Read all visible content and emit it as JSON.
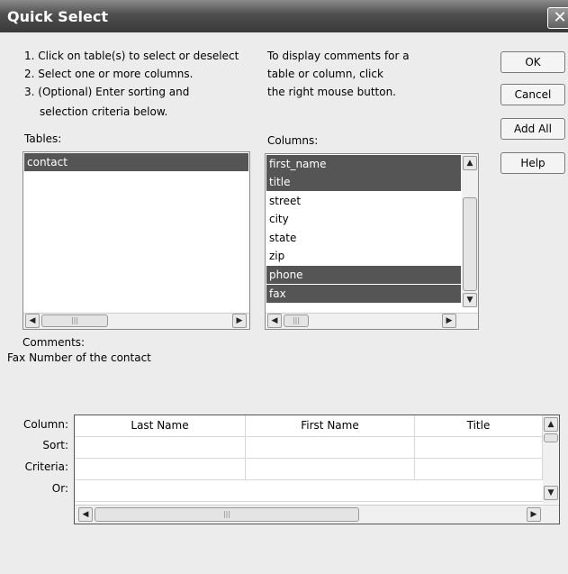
{
  "window": {
    "title": "Quick Select",
    "close_glyph": "✕"
  },
  "instructions": {
    "left": [
      "1. Click on table(s) to select or deselect",
      "2. Select one or more columns.",
      "3. (Optional) Enter sorting and",
      "selection criteria below."
    ],
    "right": [
      "To display comments for a",
      "table or column, click",
      "the right mouse button."
    ]
  },
  "buttons": {
    "ok": "OK",
    "cancel": "Cancel",
    "add_all": "Add All",
    "help": "Help"
  },
  "tables": {
    "label": "Tables:",
    "items": [
      {
        "name": "contact",
        "selected": true
      }
    ]
  },
  "columns": {
    "label": "Columns:",
    "items": [
      {
        "name": "first_name",
        "selected": true
      },
      {
        "name": "title",
        "selected": true
      },
      {
        "name": "street",
        "selected": false
      },
      {
        "name": "city",
        "selected": false
      },
      {
        "name": "state",
        "selected": false
      },
      {
        "name": "zip",
        "selected": false
      },
      {
        "name": "phone",
        "selected": true
      },
      {
        "name": "fax",
        "selected": true
      }
    ]
  },
  "comments": {
    "label": "Comments:",
    "text": "Fax Number of the contact"
  },
  "criteria": {
    "row_labels": [
      "Column:",
      "Sort:",
      "Criteria:",
      "Or:"
    ],
    "columns": [
      "Last Name",
      "First Name",
      "Title"
    ]
  },
  "icons": {
    "arrow_left": "◀",
    "arrow_right": "▶",
    "arrow_up": "▲",
    "arrow_down": "▼",
    "thumb_grip": "|||"
  },
  "colors": {
    "selection": "#555555",
    "titlebar": "#4e4e4e"
  }
}
